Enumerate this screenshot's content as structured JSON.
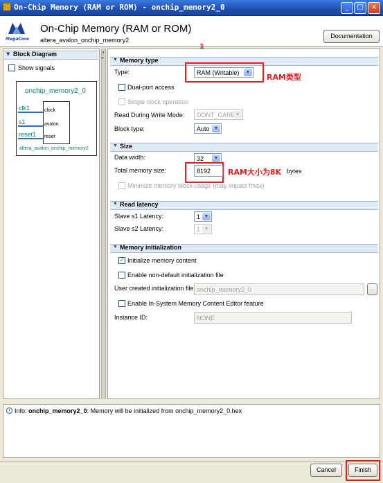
{
  "window": {
    "title": "On-Chip Memory (RAM or ROM) - onchip_memory2_0",
    "minimize": "_",
    "maximize": "□",
    "close": "×"
  },
  "header": {
    "logo_text": "MegaCore",
    "title": "On-Chip Memory (RAM or ROM)",
    "subtitle": "altera_avalon_onchip_memory2",
    "documentation_label": "Documentation"
  },
  "left": {
    "section_title": "Block Diagram",
    "show_signals_label": "Show signals",
    "block": {
      "name": "onchip_memory2_0",
      "ports": [
        {
          "left": "clk1",
          "right": "clock"
        },
        {
          "left": "s1",
          "right": "avalon"
        },
        {
          "left": "reset1",
          "right": "reset"
        }
      ],
      "component": "altera_avalon_onchip_memory2"
    }
  },
  "memory_type": {
    "title": "Memory type",
    "annotation_number": "1",
    "type_label": "Type:",
    "type_value": "RAM (Writable)",
    "type_annotation": "RAM类型",
    "dual_port_label": "Dual-port access",
    "single_clock_label": "Single clock operation",
    "read_during_write_label": "Read During Write Mode:",
    "read_during_write_value": "DONT_CARE",
    "block_type_label": "Block type:",
    "block_type_value": "Auto"
  },
  "size": {
    "title": "Size",
    "data_width_label": "Data width:",
    "data_width_value": "32",
    "total_label": "Total memory size:",
    "total_value": "8192",
    "total_annotation": "RAM大小为8K",
    "total_unit": "bytes",
    "minimize_label": "Minimize memory block usage (may impact fmax)"
  },
  "read_latency": {
    "title": "Read latency",
    "s1_label": "Slave s1 Latency:",
    "s1_value": "1",
    "s2_label": "Slave s2 Latency:",
    "s2_value": "1"
  },
  "init": {
    "title": "Memory initialization",
    "init_label": "Initialize memory content",
    "nondefault_label": "Enable non-default initialization file",
    "user_file_label": "User created initialization file:",
    "user_file_value": "onchip_memory2_0",
    "browse_label": "...",
    "insystem_label": "Enable In-System Memory Content Editor feature",
    "instance_label": "Instance ID:",
    "instance_value": "NONE"
  },
  "info": {
    "prefix": "Info: ",
    "name": "onchip_memory2_0",
    "message": ": Memory will be initialized from onchip_memory2_0.hex"
  },
  "footer": {
    "cancel_label": "Cancel",
    "finish_label": "Finish"
  },
  "colors": {
    "accent_red": "#e02020",
    "section_bg": "#e1ebf5",
    "block_teal": "#0e7a7a"
  }
}
